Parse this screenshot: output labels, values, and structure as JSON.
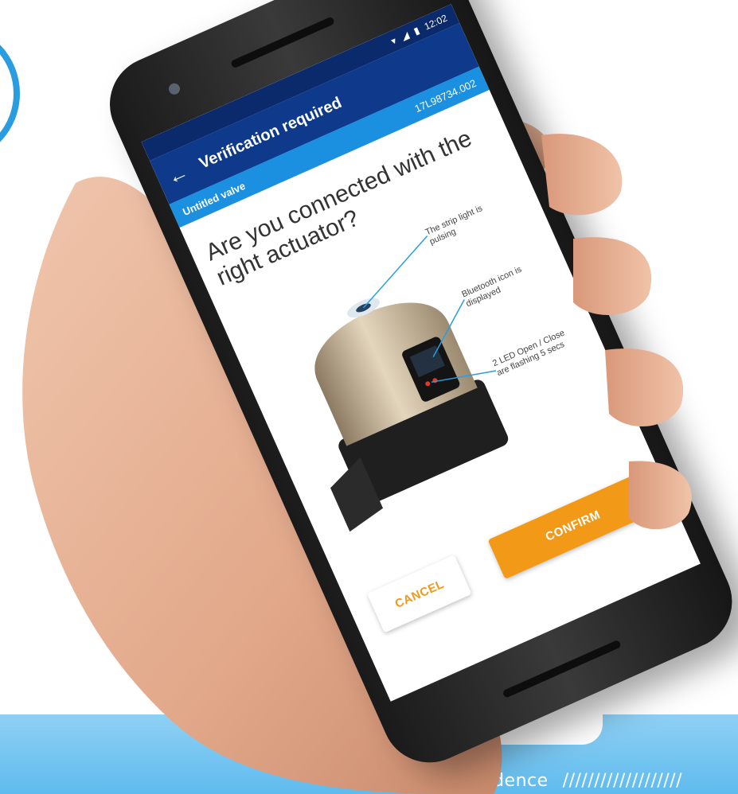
{
  "status_bar": {
    "time": "12:02",
    "icons": [
      "wifi-icon",
      "signal-icon",
      "battery-icon"
    ]
  },
  "app_bar": {
    "back_icon": "back-arrow-icon",
    "title": "Verification required"
  },
  "sub_bar": {
    "valve_name": "Untitled valve",
    "serial": "17L98734.002"
  },
  "question": "Are you connected with the right actuator?",
  "callouts": [
    "The strip light is pulsing",
    "Bluetooth icon is displayed",
    "2 LED Open / Close are flashing 5 secs"
  ],
  "buttons": {
    "cancel": "CANCEL",
    "confirm": "CONFIRM"
  },
  "banner": {
    "text": "...idence",
    "slashes": "///////////////////"
  },
  "colors": {
    "status_bar": "#0a2a6b",
    "app_bar": "#0f3a8c",
    "sub_bar": "#1b8fe0",
    "accent": "#f29a17",
    "banner": "#6cc3f0"
  }
}
